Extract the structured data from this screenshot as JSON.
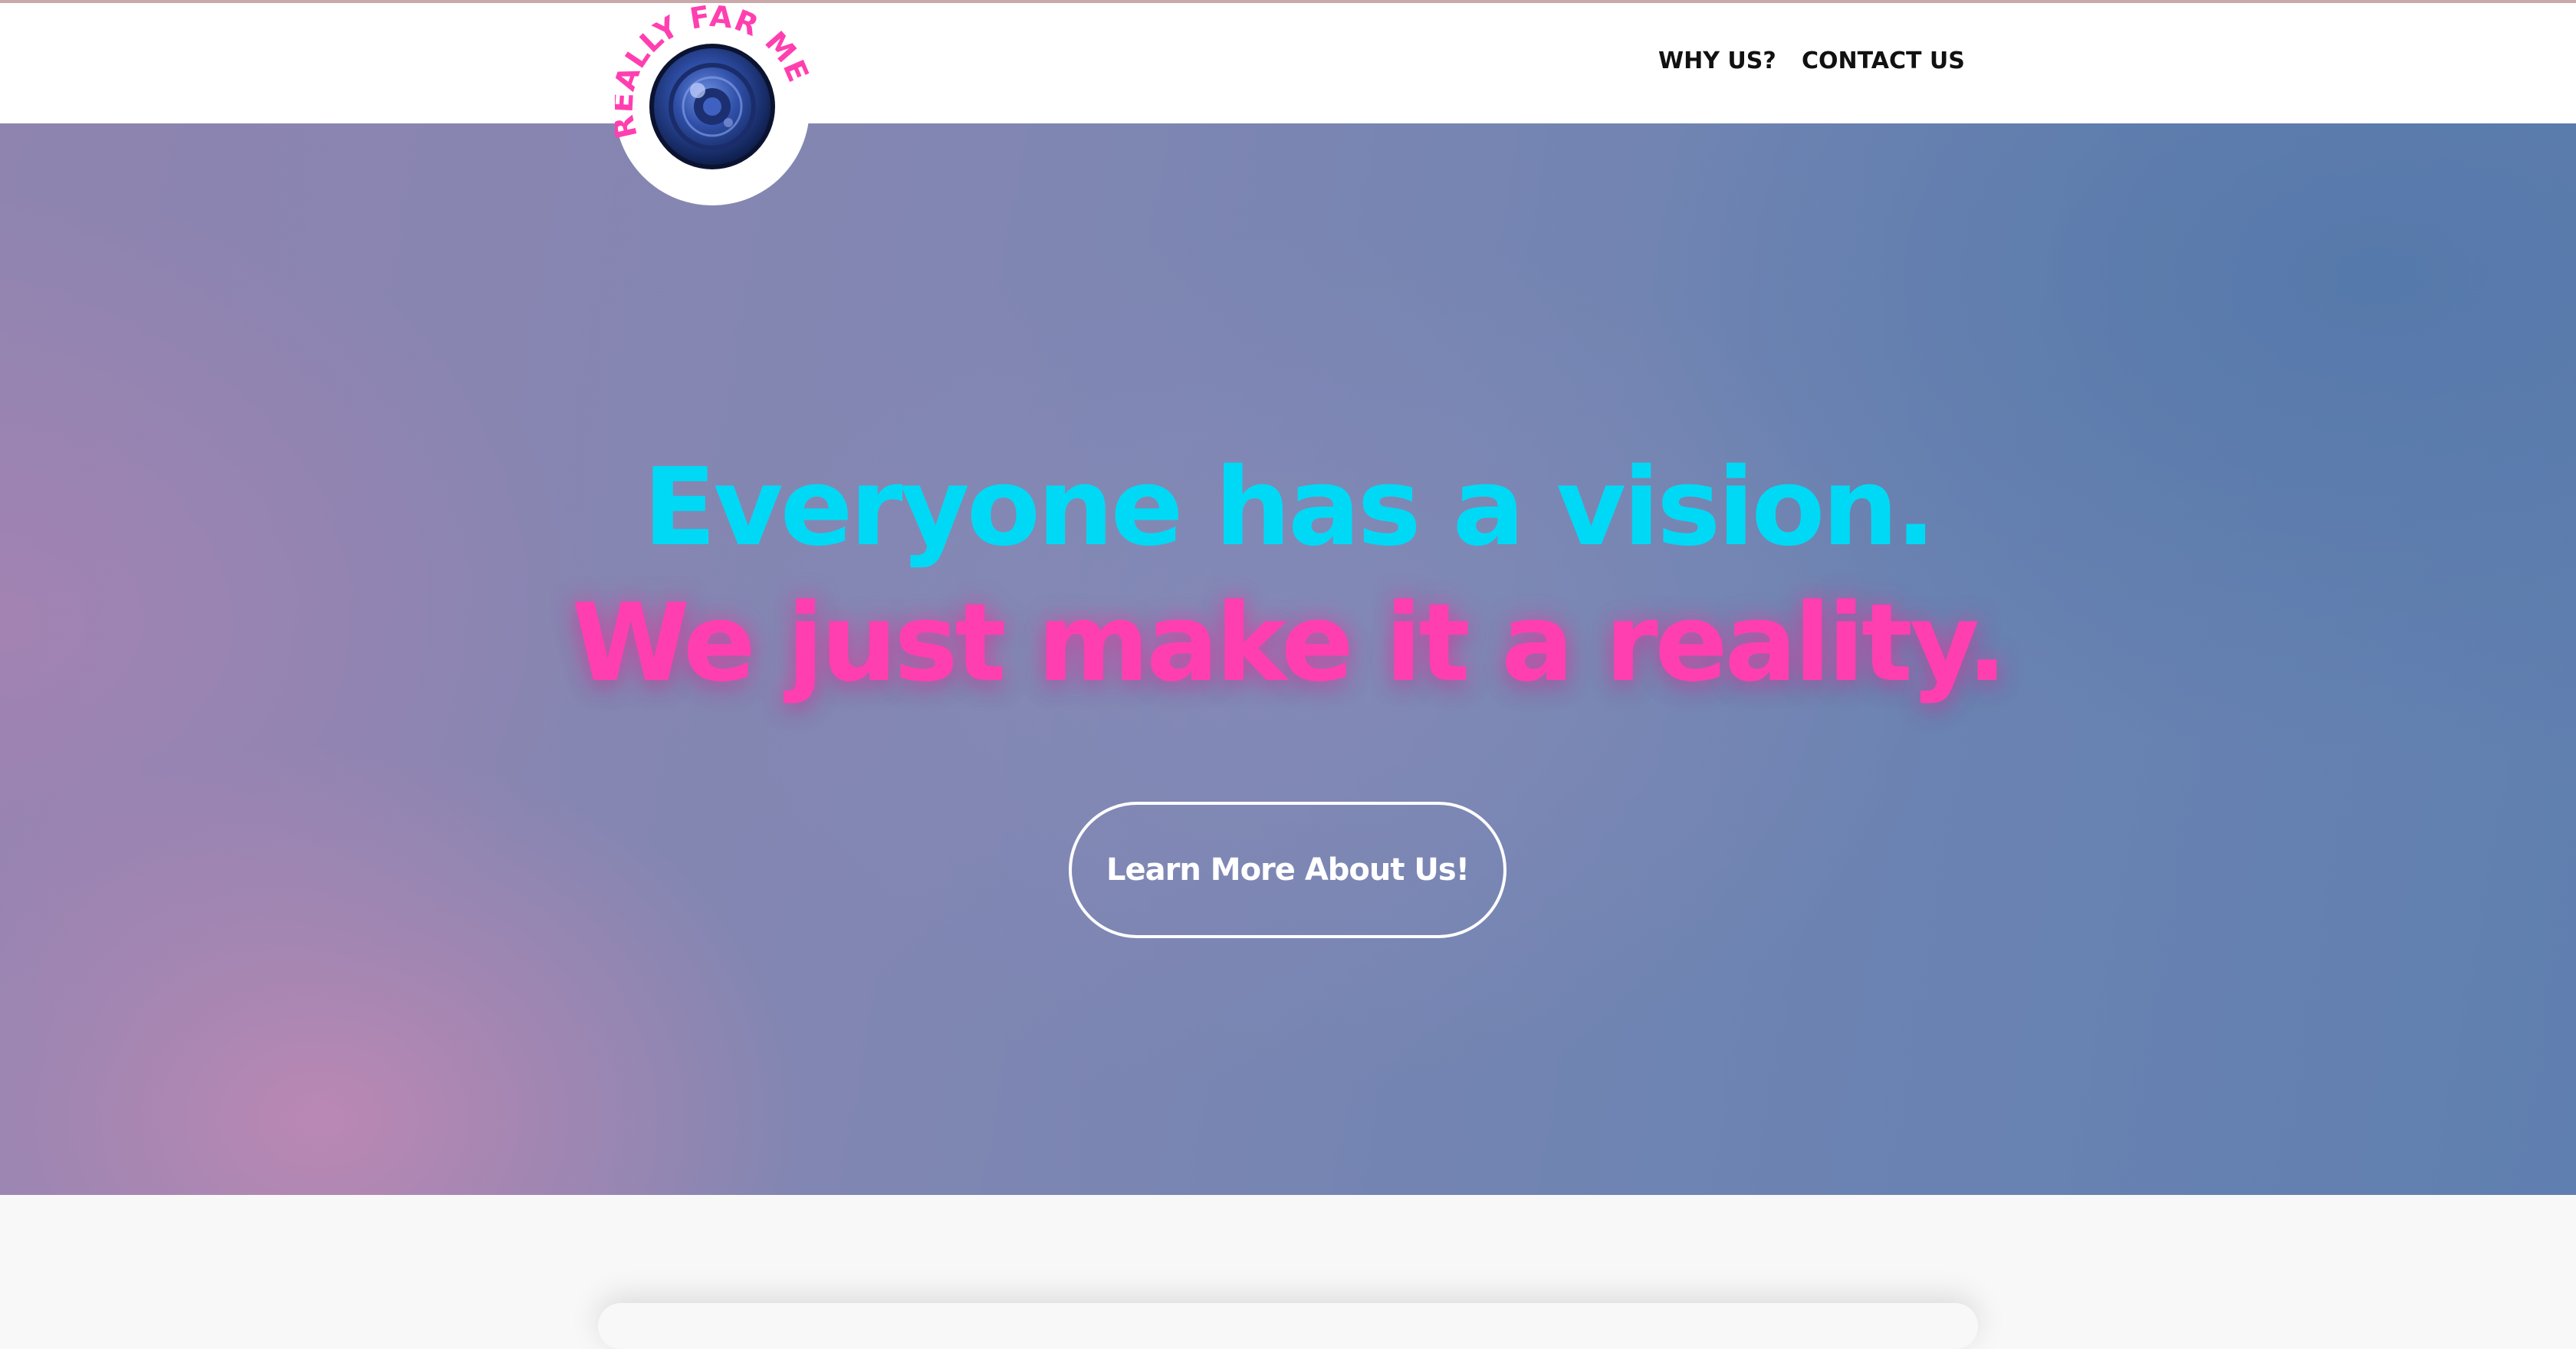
{
  "header": {
    "logo": {
      "text": "REALLY FAR MEDIA",
      "icon": "camera-lens-icon",
      "text_color": "#ff3fb0",
      "lens_color": "#2c4a9a"
    },
    "nav": [
      {
        "label": "WHY US?"
      },
      {
        "label": "CONTACT US"
      }
    ]
  },
  "hero": {
    "headline_line1": "Everyone has a vision.",
    "headline_line2": "We just make it a reality.",
    "cta_label": "Learn More About Us!",
    "colors": {
      "line1": "#00d9f5",
      "line2": "#ff3fb0",
      "cta_border": "#ffffff"
    }
  }
}
